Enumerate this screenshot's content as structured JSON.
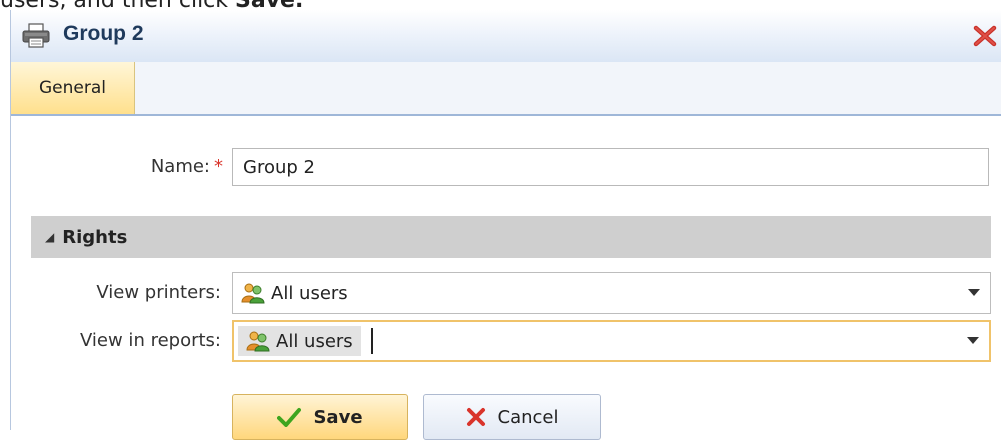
{
  "caption": {
    "prefix": "users, and then click ",
    "bold": "Save."
  },
  "window": {
    "title": "Group 2",
    "title_icon": "printer-icon",
    "close_icon": "close-icon"
  },
  "tabs": [
    {
      "label": "General",
      "active": true
    }
  ],
  "form": {
    "name_label": "Name:",
    "required_mark": "*",
    "name_value": "Group 2"
  },
  "rights": {
    "section_arrow": "◢",
    "section_title": "Rights",
    "view_printers_label": "View printers:",
    "view_printers_value": "All users",
    "view_in_reports_label": "View in reports:",
    "view_in_reports_value": "All users",
    "users_icon": "users-icon"
  },
  "buttons": {
    "save_label": "Save",
    "cancel_label": "Cancel"
  },
  "colors": {
    "accent_tab": "#ffe08d",
    "save_check": "#3ea51f",
    "cancel_x": "#d9342b",
    "title_text": "#1f3a5c"
  }
}
